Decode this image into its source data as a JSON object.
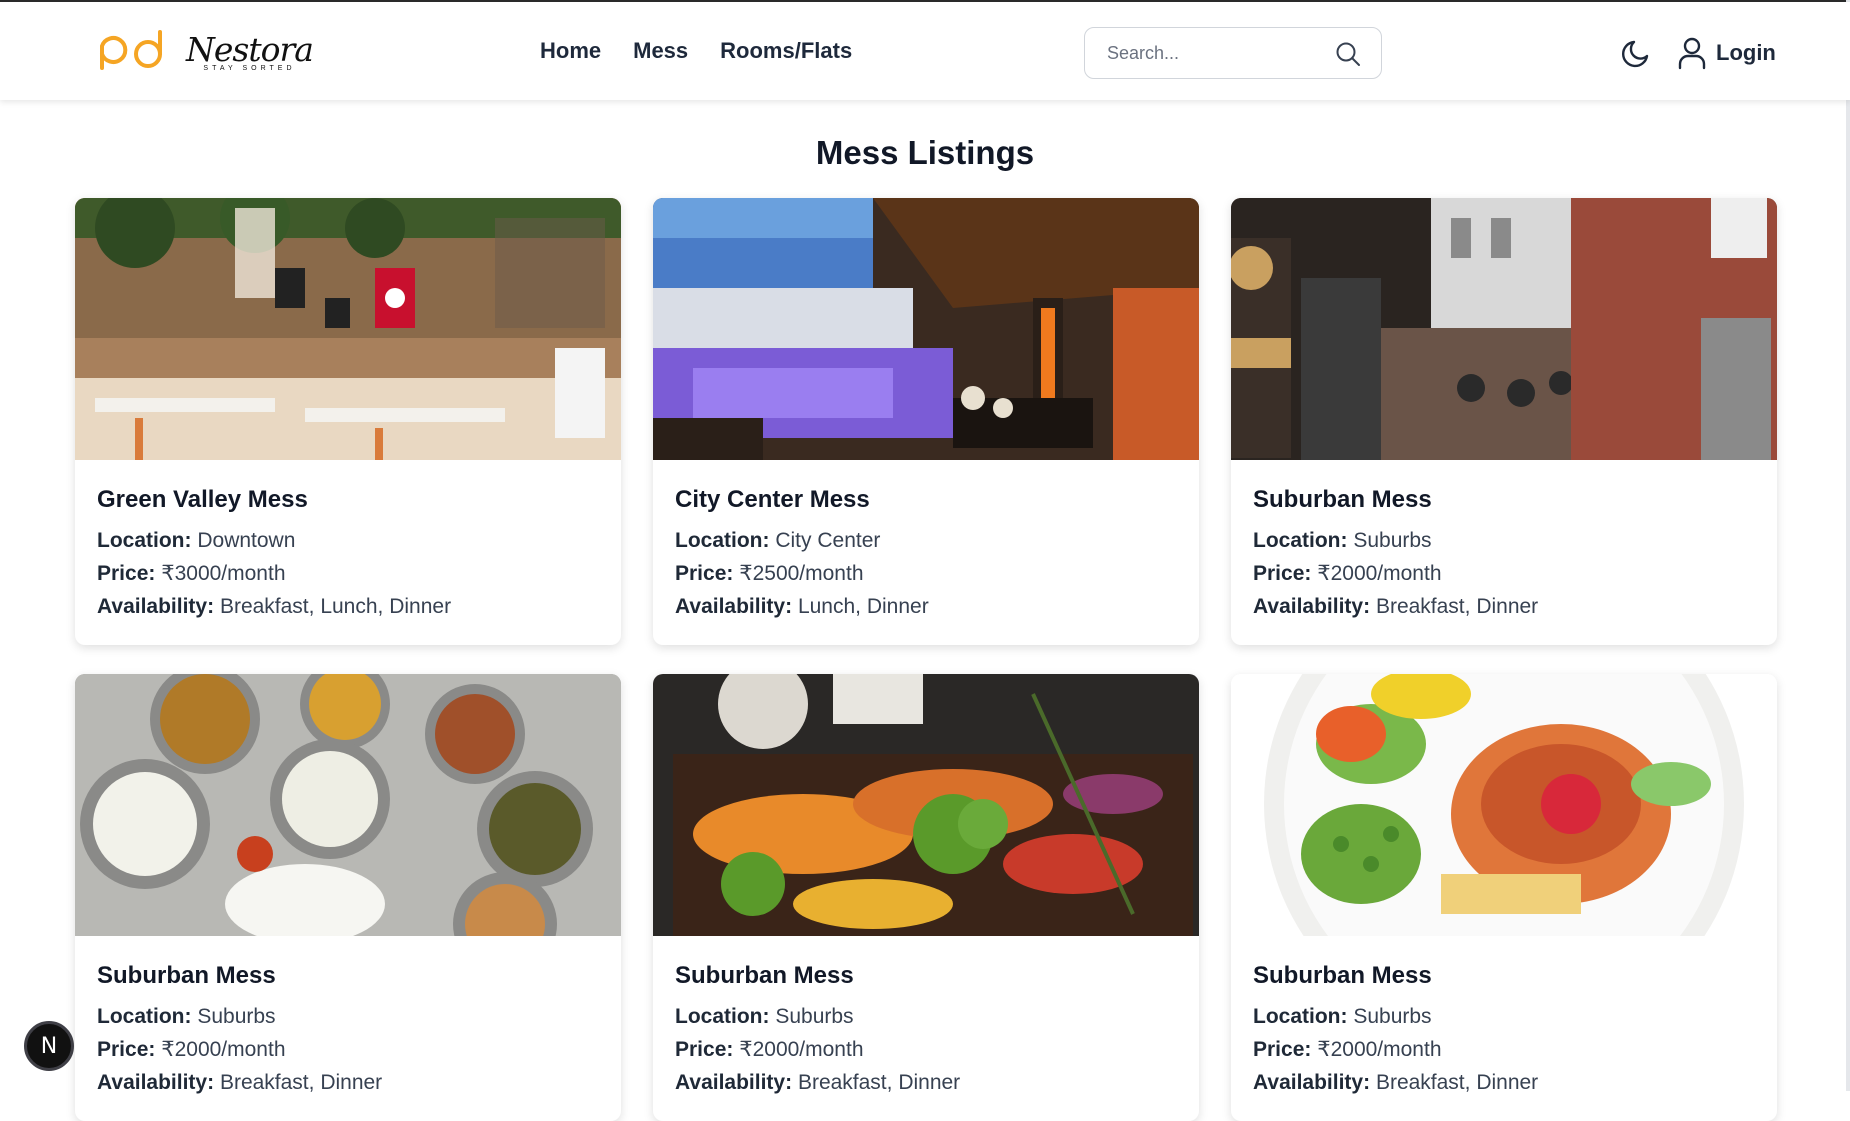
{
  "brand": {
    "name": "Nestora",
    "tagline": "STAY SORTED"
  },
  "nav": {
    "home": "Home",
    "mess": "Mess",
    "rooms": "Rooms/Flats"
  },
  "search": {
    "placeholder": "Search..."
  },
  "header": {
    "login": "Login"
  },
  "page": {
    "title": "Mess Listings"
  },
  "labels": {
    "location": "Location:",
    "price": "Price:",
    "availability": "Availability:"
  },
  "listings": [
    {
      "name": "Green Valley Mess",
      "location": "Downtown",
      "price": "₹3000/month",
      "availability": "Breakfast, Lunch, Dinner",
      "image": "cafe-interior-photo"
    },
    {
      "name": "City Center Mess",
      "location": "City Center",
      "price": "₹2500/month",
      "availability": "Lunch, Dinner",
      "image": "poolside-restaurant-photo"
    },
    {
      "name": "Suburban Mess",
      "location": "Suburbs",
      "price": "₹2000/month",
      "availability": "Breakfast, Dinner",
      "image": "street-restaurant-photo"
    },
    {
      "name": "Suburban Mess",
      "location": "Suburbs",
      "price": "₹2000/month",
      "availability": "Breakfast, Dinner",
      "image": "thali-plate-photo"
    },
    {
      "name": "Suburban Mess",
      "location": "Suburbs",
      "price": "₹2000/month",
      "availability": "Breakfast, Dinner",
      "image": "roasted-vegetables-photo"
    },
    {
      "name": "Suburban Mess",
      "location": "Suburbs",
      "price": "₹2000/month",
      "availability": "Breakfast, Dinner",
      "image": "chicken-plate-photo"
    }
  ],
  "dev_badge": {
    "letter": "N"
  },
  "colors": {
    "brand_orange": "#f5a524",
    "text_dark": "#1e293b"
  }
}
